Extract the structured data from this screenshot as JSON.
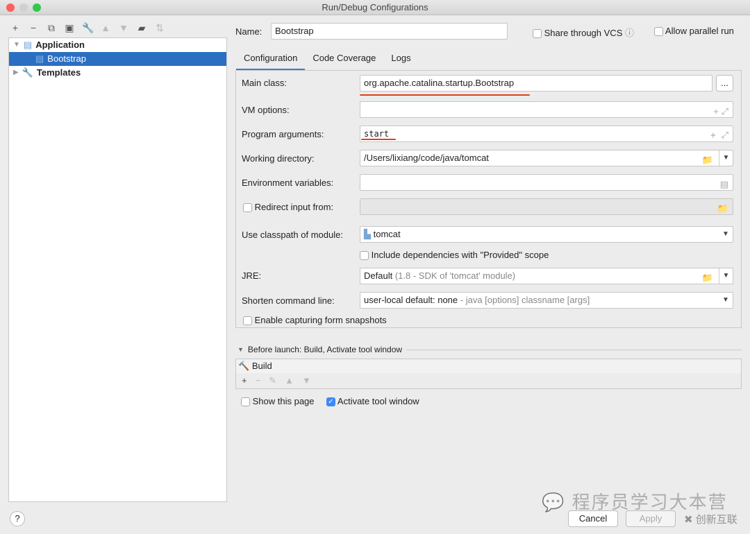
{
  "window": {
    "title": "Run/Debug Configurations"
  },
  "sidebar": {
    "tree": [
      {
        "label": "Application"
      },
      {
        "label": "Bootstrap"
      },
      {
        "label": "Templates"
      }
    ]
  },
  "header": {
    "name_label": "Name:",
    "name_value": "Bootstrap",
    "share_vcs": "Share through VCS",
    "allow_parallel": "Allow parallel run"
  },
  "tabs": [
    {
      "label": "Configuration"
    },
    {
      "label": "Code Coverage"
    },
    {
      "label": "Logs"
    }
  ],
  "form": {
    "main_class_label": "Main class:",
    "main_class": "org.apache.catalina.startup.Bootstrap",
    "browse": "...",
    "vm_options_label": "VM options:",
    "vm_options": "",
    "program_args_label": "Program arguments:",
    "program_args": "start",
    "working_dir_label": "Working directory:",
    "working_dir": "/Users/lixiang/code/java/tomcat",
    "env_label": "Environment variables:",
    "env": "",
    "redirect_label": "Redirect input from:",
    "classpath_label": "Use classpath of module:",
    "classpath": "tomcat",
    "include_deps": "Include dependencies with \"Provided\" scope",
    "jre_label": "JRE:",
    "jre": "Default",
    "jre_hint": "(1.8 - SDK of 'tomcat' module)",
    "shorten_label": "Shorten command line:",
    "shorten": "user-local default: none",
    "shorten_hint": "- java [options] classname [args]",
    "snapshots": "Enable capturing form snapshots"
  },
  "before_launch": {
    "title": "Before launch: Build, Activate tool window",
    "items": [
      "Build"
    ],
    "show_page": "Show this page",
    "activate": "Activate tool window",
    "activate_checked": true
  },
  "footer": {
    "help": "?",
    "cancel": "Cancel",
    "apply": "Apply"
  },
  "watermark": {
    "text1": "程序员学习大本营",
    "text2": "创新互联"
  }
}
